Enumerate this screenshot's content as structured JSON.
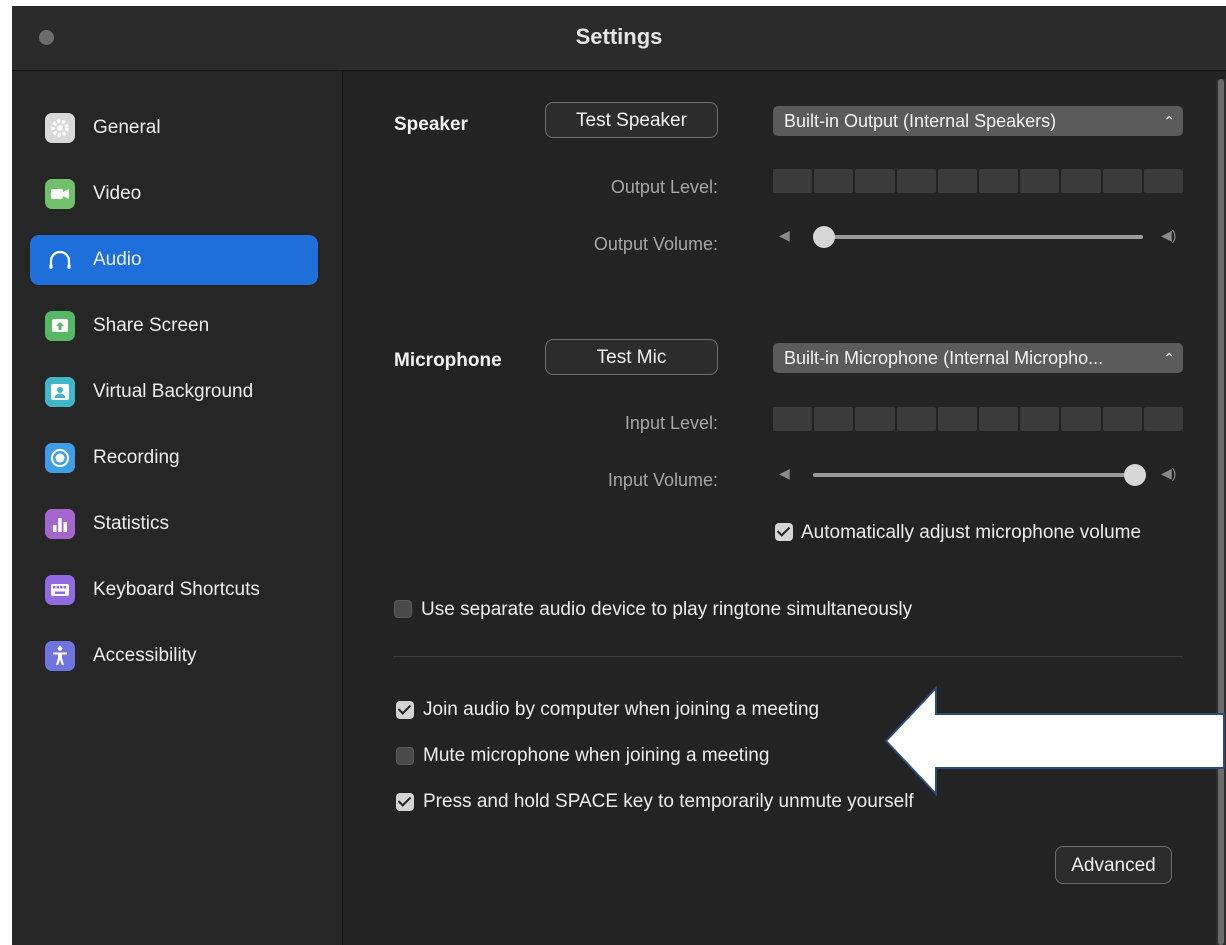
{
  "window": {
    "title": "Settings"
  },
  "sidebar": {
    "items": [
      {
        "label": "General",
        "icon": "gear-icon",
        "color": "#d9d9d9",
        "active": false
      },
      {
        "label": "Video",
        "icon": "video-camera-icon",
        "color": "#72c06c",
        "active": false
      },
      {
        "label": "Audio",
        "icon": "headphones-icon",
        "color": "#1e6fd9",
        "active": true
      },
      {
        "label": "Share Screen",
        "icon": "share-screen-icon",
        "color": "#56b865",
        "active": false
      },
      {
        "label": "Virtual Background",
        "icon": "virtual-background-icon",
        "color": "#3fb7c9",
        "active": false
      },
      {
        "label": "Recording",
        "icon": "recording-icon",
        "color": "#3f9ee6",
        "active": false
      },
      {
        "label": "Statistics",
        "icon": "statistics-icon",
        "color": "#a466cc",
        "active": false
      },
      {
        "label": "Keyboard Shortcuts",
        "icon": "keyboard-icon",
        "color": "#8f6ae0",
        "active": false
      },
      {
        "label": "Accessibility",
        "icon": "accessibility-icon",
        "color": "#6f73de",
        "active": false
      }
    ]
  },
  "speaker": {
    "label": "Speaker",
    "test_button": "Test Speaker",
    "device": "Built-in Output (Internal Speakers)",
    "output_level_label": "Output Level:",
    "output_volume_label": "Output Volume:",
    "volume_fraction": 0.0
  },
  "microphone": {
    "label": "Microphone",
    "test_button": "Test Mic",
    "device": "Built-in Microphone (Internal Micropho...",
    "input_level_label": "Input Level:",
    "input_volume_label": "Input Volume:",
    "volume_fraction": 1.0,
    "auto_adjust_label": "Automatically adjust microphone volume",
    "auto_adjust_checked": true
  },
  "options": {
    "separate_ringtone_label": "Use separate audio device to play ringtone simultaneously",
    "separate_ringtone_checked": false,
    "join_audio_label": "Join audio by computer when joining a meeting",
    "join_audio_checked": true,
    "mute_mic_label": "Mute microphone when joining a meeting",
    "mute_mic_checked": false,
    "space_unmute_label": "Press and hold SPACE key to temporarily unmute yourself",
    "space_unmute_checked": true
  },
  "advanced_button": "Advanced",
  "colors": {
    "accent": "#1e6fd9",
    "window_bg": "#232323",
    "annotation_arrow": "#ffffff"
  }
}
